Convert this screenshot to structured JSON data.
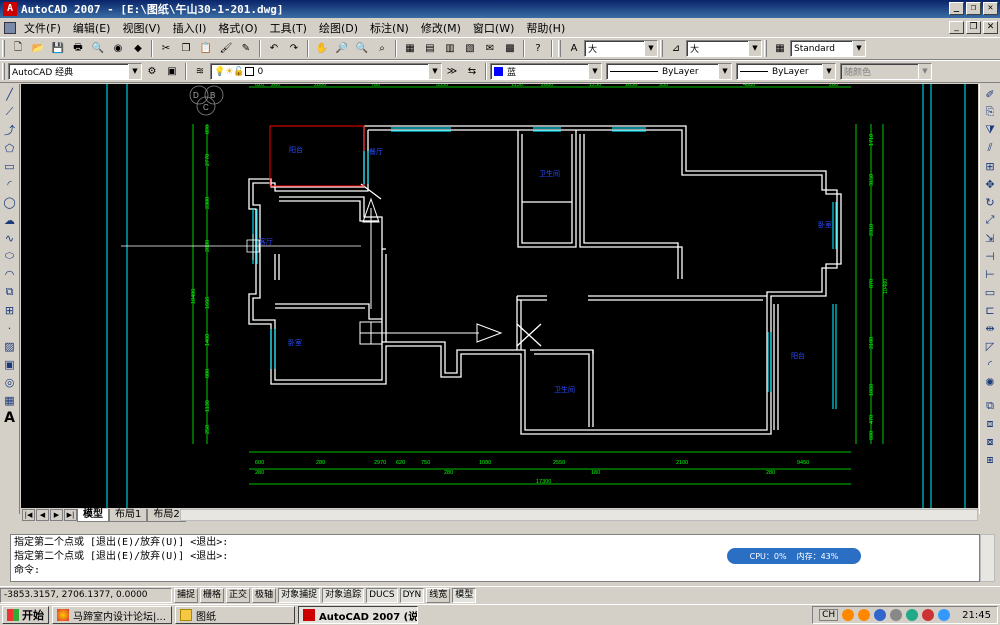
{
  "window": {
    "title": "AutoCAD 2007 - [E:\\图纸\\午山30-1-201.dwg]",
    "controls": [
      "_",
      "❐",
      "✕"
    ]
  },
  "menu": {
    "items": [
      "文件(F)",
      "编辑(E)",
      "视图(V)",
      "插入(I)",
      "格式(O)",
      "工具(T)",
      "绘图(D)",
      "标注(N)",
      "修改(M)",
      "窗口(W)",
      "帮助(H)"
    ]
  },
  "toolbar_std": {
    "text_style": "大",
    "dim_style": "大",
    "table_style": "Standard"
  },
  "toolbar_layers": {
    "workspace": "AutoCAD 经典",
    "layer": "0",
    "color": "蓝",
    "linetype": "ByLayer",
    "lineweight": "ByLayer",
    "plotstyle": "随颜色"
  },
  "drawing": {
    "logo_letters": [
      "D",
      "B",
      "C"
    ],
    "rooms": [
      "阳台",
      "餐厅",
      "卫生间",
      "客厅",
      "卧室",
      "卫生间",
      "阳台",
      "卧室"
    ],
    "dims_top": [
      "620",
      "280",
      "2800",
      "780",
      "3550",
      "1150",
      "2800",
      "1250",
      "1650",
      "950",
      "4880",
      "280"
    ],
    "dims_bottom": [
      "600",
      "280",
      "2970",
      "620",
      "750",
      "1080",
      "2550",
      "2100",
      "9450",
      "1920"
    ],
    "dims_bottom2": [
      "280",
      "280",
      "180",
      "280"
    ],
    "dims_total": "17300",
    "dims_left": [
      "890",
      "2770",
      "2300",
      "2830",
      "1660",
      "1400",
      "800",
      "1130",
      "250"
    ],
    "dims_left_total": "10480",
    "dims_right": [
      "1710",
      "3150",
      "2310",
      "870",
      "2180",
      "1860",
      "470",
      "600"
    ],
    "dims_right_total": "10480"
  },
  "layout_tabs": [
    "模型",
    "布局1",
    "布局2"
  ],
  "command": {
    "history": [
      "指定第二个点或 [退出(E)/放弃(U)] <退出>:",
      "指定第二个点或 [退出(E)/放弃(U)] <退出>:"
    ],
    "prompt": "命令:"
  },
  "popup": {
    "cpu": "CPU：0%",
    "mem": "内存：43%"
  },
  "status": {
    "coords": "-3853.3157, 2706.1377, 0.0000",
    "toggles": [
      "捕捉",
      "栅格",
      "正交",
      "极轴",
      "对象捕捉",
      "对象追踪",
      "DUCS",
      "DYN",
      "线宽",
      "模型"
    ],
    "toggles_on": [
      "对象捕捉",
      "对象追踪",
      "DUCS",
      "DYN",
      "模型"
    ]
  },
  "taskbar": {
    "start": "开始",
    "tasks": [
      "马蹄室内设计论坛|...",
      "图纸",
      "AutoCAD 2007 (说..."
    ],
    "ime": "CH",
    "clock": "21:45"
  },
  "colors": {
    "canvas": "#000000",
    "wall": "#ffffff",
    "dim": "#00ff00",
    "window": "#00ffff",
    "text": "#0000ff",
    "accent_red": "#ff0000"
  }
}
